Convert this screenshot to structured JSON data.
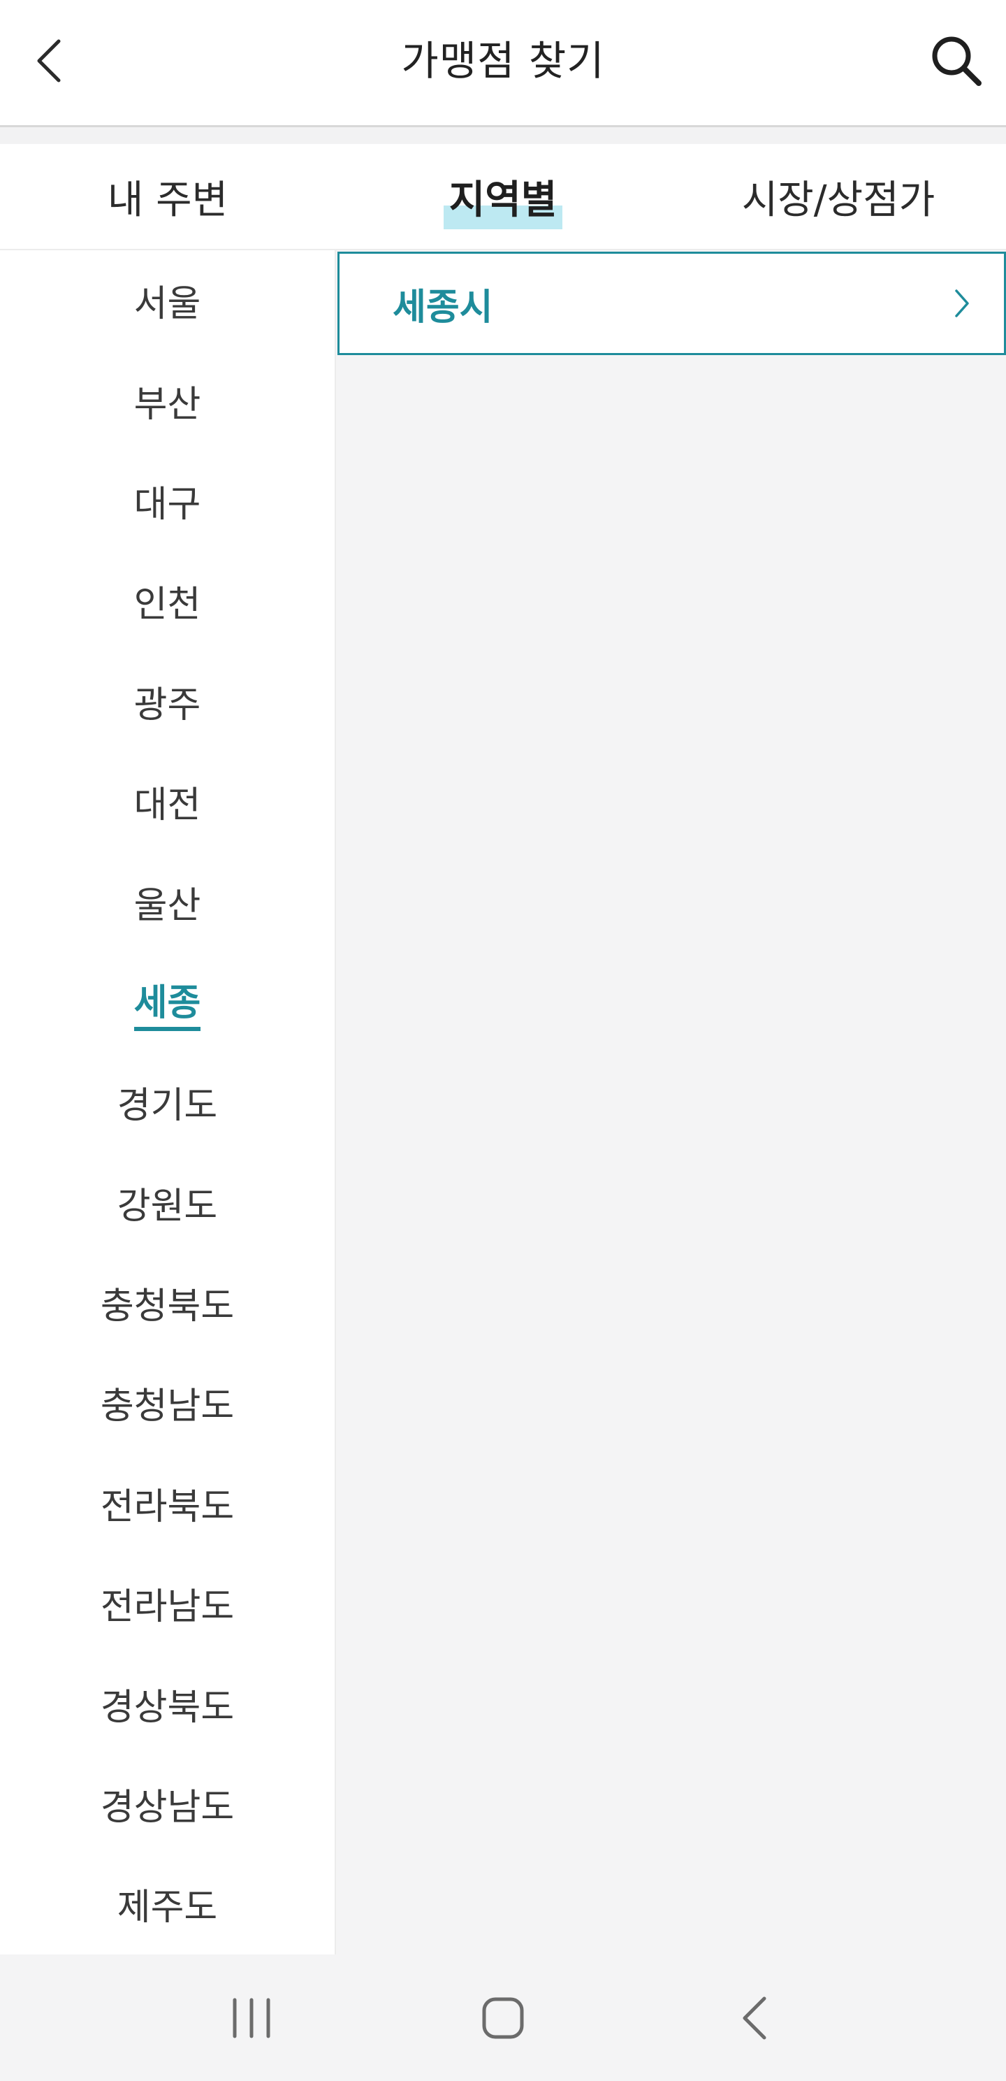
{
  "header": {
    "title": "가맹점 찾기",
    "back_icon": "chevron-left-icon",
    "search_icon": "search-icon"
  },
  "tabs": [
    {
      "label": "내 주변",
      "active": false
    },
    {
      "label": "지역별",
      "active": true
    },
    {
      "label": "시장/상점가",
      "active": false
    }
  ],
  "regions": [
    {
      "label": "서울"
    },
    {
      "label": "부산"
    },
    {
      "label": "대구"
    },
    {
      "label": "인천"
    },
    {
      "label": "광주"
    },
    {
      "label": "대전"
    },
    {
      "label": "울산"
    },
    {
      "label": "세종",
      "selected": true
    },
    {
      "label": "경기도"
    },
    {
      "label": "강원도"
    },
    {
      "label": "충청북도"
    },
    {
      "label": "충청남도"
    },
    {
      "label": "전라북도"
    },
    {
      "label": "전라남도"
    },
    {
      "label": "경상북도"
    },
    {
      "label": "경상남도"
    },
    {
      "label": "제주도"
    }
  ],
  "sub_regions": [
    {
      "label": "세종시",
      "icon": "chevron-right-icon"
    }
  ],
  "nav_bar": {
    "recents_icon": "recent-apps-icon",
    "home_icon": "home-icon",
    "back_icon": "back-icon"
  },
  "colors": {
    "accent": "#1e8c9b",
    "tab_highlight": "#bde9f2",
    "background": "#f4f4f5"
  }
}
